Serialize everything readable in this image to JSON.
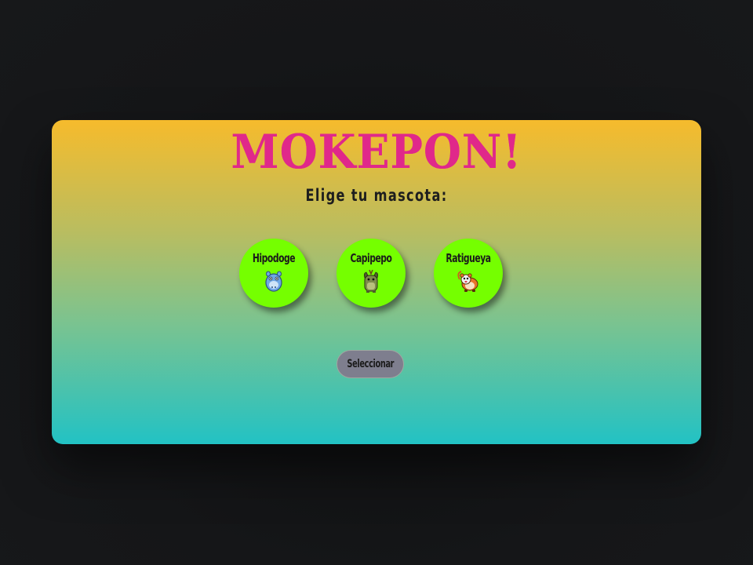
{
  "game": {
    "title": "MOKEPON!",
    "prompt": "Elige tu mascota:"
  },
  "pets": [
    {
      "name": "Hipodoge",
      "icon": "hipodoge-icon"
    },
    {
      "name": "Capipepo",
      "icon": "capipepo-icon"
    },
    {
      "name": "Ratigueya",
      "icon": "ratigueya-icon"
    }
  ],
  "actions": {
    "select_label": "Seleccionar"
  },
  "colors": {
    "title": "#e0288a",
    "pet_button": "#75ff00",
    "select_button": "#7e7e8e",
    "card_top": "#f6bb2c",
    "card_bottom": "#22c2c4"
  }
}
